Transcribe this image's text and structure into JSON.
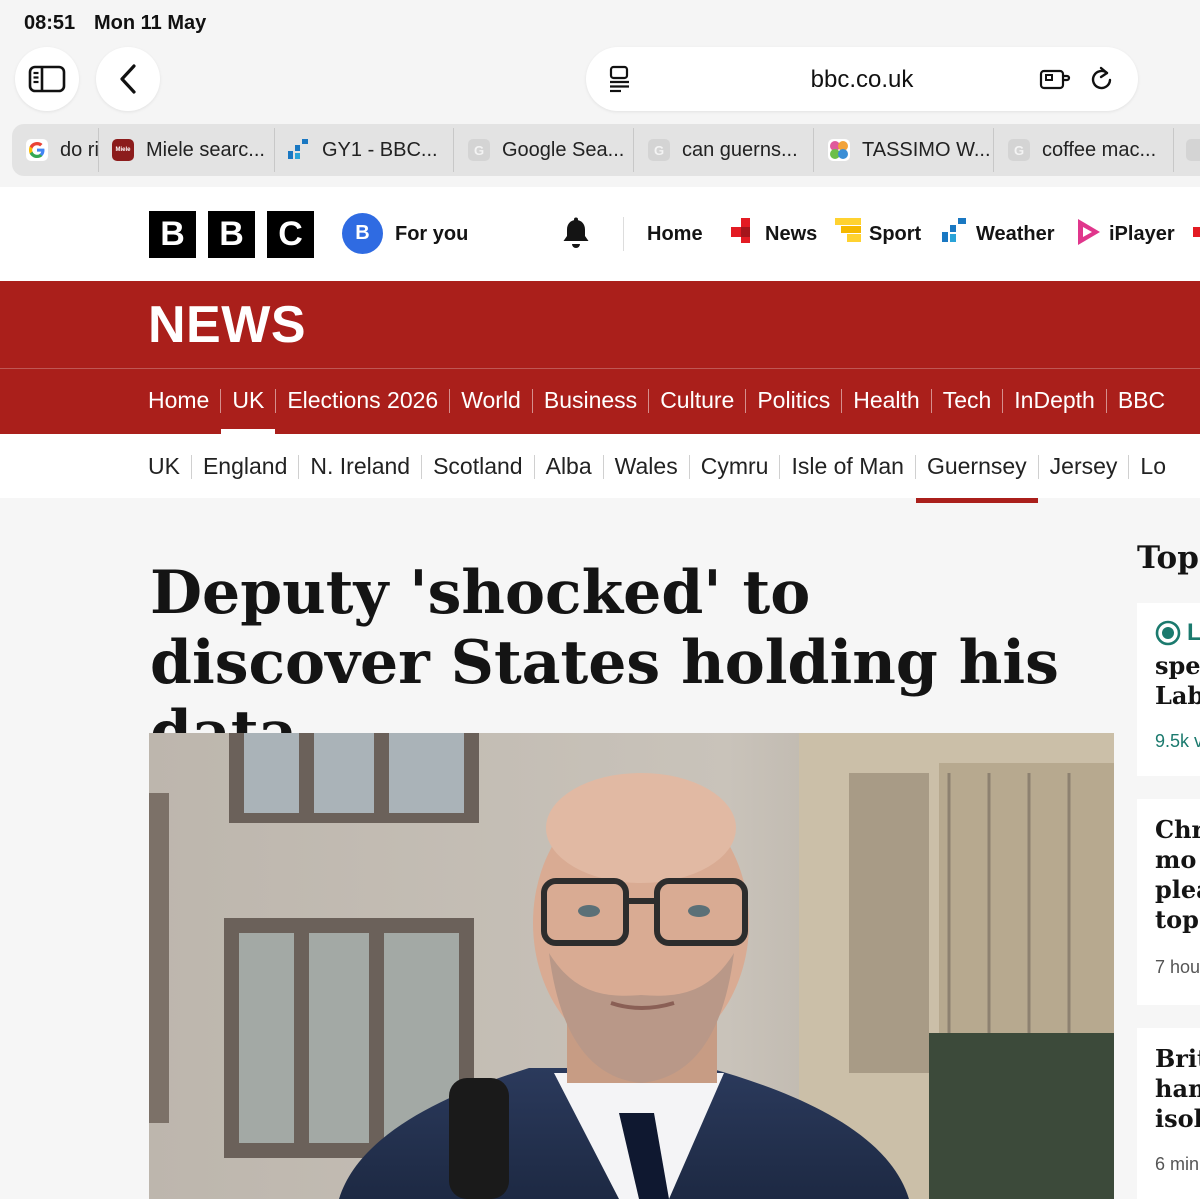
{
  "status_bar": {
    "time": "08:51",
    "date": "Mon 11 May"
  },
  "browser": {
    "url": "bbc.co.uk",
    "tabs": [
      {
        "title": "do ri",
        "favicon": "google-icon"
      },
      {
        "title": "Miele searc...",
        "favicon": "miele-icon"
      },
      {
        "title": "GY1 - BBC...",
        "favicon": "bbc-weather-icon"
      },
      {
        "title": "Google Sea...",
        "favicon": "generic-g-icon"
      },
      {
        "title": "can guerns...",
        "favicon": "generic-g-icon"
      },
      {
        "title": "TASSIMO W...",
        "favicon": "tassimo-icon"
      },
      {
        "title": "coffee mac...",
        "favicon": "generic-g-icon"
      }
    ]
  },
  "bbc_header": {
    "logo": [
      "B",
      "B",
      "C"
    ],
    "for_you": {
      "avatar": "B",
      "label": "For you"
    },
    "nav": {
      "home": "Home",
      "news": "News",
      "sport": "Sport",
      "weather": "Weather",
      "iplayer": "iPlayer"
    }
  },
  "news_band": {
    "title": "NEWS",
    "nav": [
      "Home",
      "UK",
      "Elections 2026",
      "World",
      "Business",
      "Culture",
      "Politics",
      "Health",
      "Tech",
      "InDepth",
      "BBC"
    ],
    "active": "UK"
  },
  "sub_nav": {
    "items": [
      "UK",
      "England",
      "N. Ireland",
      "Scotland",
      "Alba",
      "Wales",
      "Cymru",
      "Isle of Man",
      "Guernsey",
      "Jersey",
      "Lo"
    ],
    "active": "Guernsey"
  },
  "article": {
    "headline": "Deputy 'shocked' to discover States holding his data"
  },
  "sidebar": {
    "heading": "Top",
    "stories": [
      {
        "live": "L",
        "title": "spe\nLab",
        "meta": "9.5k v"
      },
      {
        "title": "Chr\nmo\nplea\ntop",
        "meta": "7 hou"
      },
      {
        "title": "Brit\nham\nisol",
        "meta": "6 min"
      }
    ]
  },
  "colors": {
    "bbc_red": "#aa1f1b",
    "live_green": "#1b7a6e",
    "avatar_blue": "#2f6be2"
  }
}
